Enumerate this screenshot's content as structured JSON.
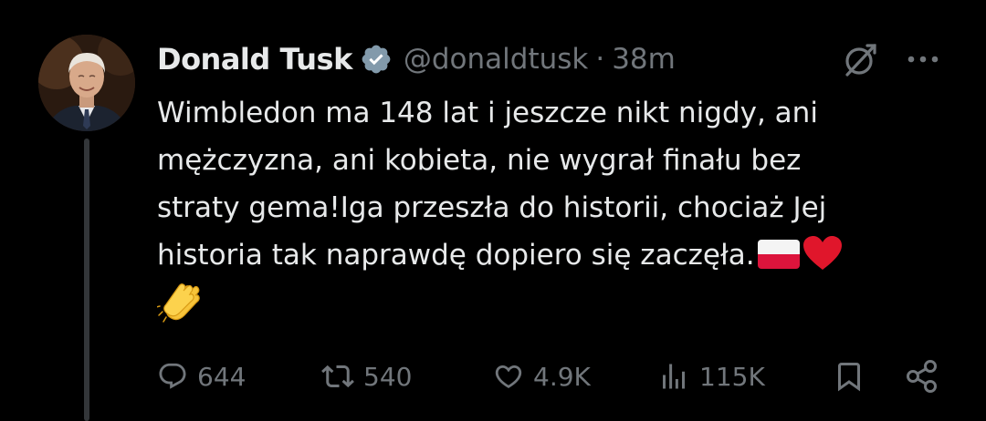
{
  "author": {
    "name": "Donald Tusk",
    "handle": "@donaldtusk",
    "separator": "·",
    "time": "38m",
    "verified": true
  },
  "tweet": {
    "lines": [
      "Wimbledon ma 148 lat i jeszcze nikt nigdy, ani",
      "mężczyzna, ani kobieta, nie wygrał finału bez",
      "straty gema!Iga przeszła do historii, chociaż Jej",
      "historia tak naprawdę dopiero się zaczęła."
    ],
    "emojis": [
      "poland-flag",
      "red-heart",
      "clapping-hands"
    ]
  },
  "actions": {
    "replies": "644",
    "reposts": "540",
    "likes": "4.9K",
    "views": "115K"
  },
  "icons": {
    "verified": "verified-badge-icon",
    "grok": "grok-icon",
    "more": "more-options-icon",
    "reply": "reply-icon",
    "repost": "repost-icon",
    "like": "heart-icon",
    "views": "views-icon",
    "bookmark": "bookmark-icon",
    "share": "share-icon"
  },
  "colors": {
    "background": "#000000",
    "text": "#e7e9ea",
    "secondary": "#71767b",
    "thread_line": "#333639",
    "heart": "#e0162b"
  }
}
